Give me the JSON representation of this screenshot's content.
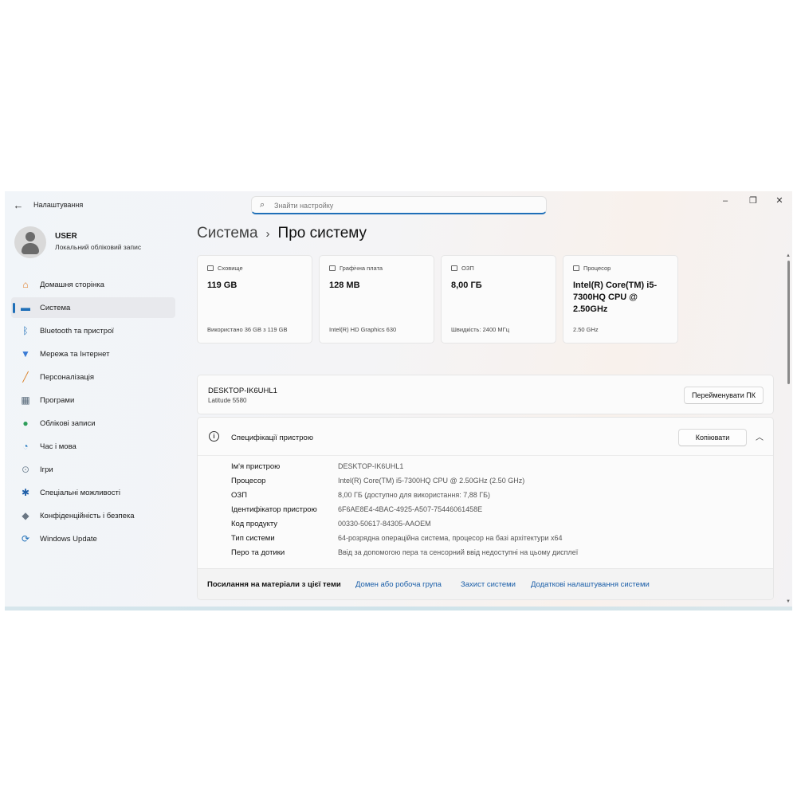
{
  "app": {
    "title": "Налаштування",
    "back_icon": "←",
    "window_controls": {
      "minimize": "–",
      "maximize": "❐",
      "close": "✕"
    }
  },
  "search": {
    "placeholder": "Знайти настройку"
  },
  "user": {
    "name": "USER",
    "subtitle": "Локальний обліковий запис"
  },
  "sidebar": {
    "items": [
      {
        "label": "Домашня сторінка",
        "icon": "home-icon",
        "glyph": "⌂",
        "color": "#e07b24",
        "active": false
      },
      {
        "label": "Система",
        "icon": "system-icon",
        "glyph": "▬",
        "color": "#1f6fb8",
        "active": true
      },
      {
        "label": "Bluetooth та пристрої",
        "icon": "bluetooth-icon",
        "glyph": "ᛒ",
        "color": "#1f6fb8",
        "active": false
      },
      {
        "label": "Мережа та Інтернет",
        "icon": "network-icon",
        "glyph": "▼",
        "color": "#3a7bd5",
        "active": false
      },
      {
        "label": "Персоналізація",
        "icon": "brush-icon",
        "glyph": "╱",
        "color": "#d9822b",
        "active": false
      },
      {
        "label": "Програми",
        "icon": "apps-icon",
        "glyph": "▦",
        "color": "#5a6b7b",
        "active": false
      },
      {
        "label": "Облікові записи",
        "icon": "accounts-icon",
        "glyph": "●",
        "color": "#2e9e5a",
        "active": false
      },
      {
        "label": "Час і мова",
        "icon": "time-language-icon",
        "glyph": "◔",
        "color": "#2f7fc1",
        "active": false
      },
      {
        "label": "Ігри",
        "icon": "gamepad-icon",
        "glyph": "⊙",
        "color": "#7a8a99",
        "active": false
      },
      {
        "label": "Спеціальні можливості",
        "icon": "accessibility-icon",
        "glyph": "✱",
        "color": "#1f5fa8",
        "active": false
      },
      {
        "label": "Конфіденційність і безпека",
        "icon": "shield-icon",
        "glyph": "◆",
        "color": "#6b7784",
        "active": false
      },
      {
        "label": "Windows Update",
        "icon": "windows-update-icon",
        "glyph": "⟳",
        "color": "#1f6fb8",
        "active": false
      }
    ]
  },
  "breadcrumb": {
    "parent": "Система",
    "separator": "›",
    "current": "Про систему"
  },
  "cards": [
    {
      "title": "Сховище",
      "icon": "storage-icon",
      "value": "119 GB",
      "footer": "Використано 36 GB з 119 GB"
    },
    {
      "title": "Графічна плата",
      "icon": "gpu-icon",
      "value": "128 MB",
      "footer": "Intel(R) HD Graphics 630"
    },
    {
      "title": "ОЗП",
      "icon": "ram-icon",
      "value": "8,00 ГБ",
      "footer": "Швидкість: 2400 МГц"
    },
    {
      "title": "Процесор",
      "icon": "cpu-icon",
      "value": "Intel(R) Core(TM) i5-7300HQ CPU @ 2.50GHz",
      "footer": "2.50 GHz"
    }
  ],
  "pc": {
    "name": "DESKTOP-IK6UHL1",
    "model": "Latitude 5580",
    "rename_label": "Перейменувати ПК"
  },
  "specs": {
    "title": "Специфікації пристрою",
    "copy_label": "Копіювати",
    "rows": [
      {
        "label": "Ім'я пристрою",
        "value": "DESKTOP-IK6UHL1"
      },
      {
        "label": "Процесор",
        "value": "Intel(R) Core(TM) i5-7300HQ CPU @ 2.50GHz (2.50 GHz)"
      },
      {
        "label": "ОЗП",
        "value": "8,00 ГБ (доступно для використання: 7,88 ГБ)"
      },
      {
        "label": "Ідентифікатор пристрою",
        "value": "6F6AE8E4-4BAC-4925-A507-75446061458E"
      },
      {
        "label": "Код продукту",
        "value": "00330-50617-84305-AAOEM"
      },
      {
        "label": "Тип системи",
        "value": "64-розрядна операційна система, процесор на базі архітектури x64"
      },
      {
        "label": "Перо та дотики",
        "value": "Ввід за допомогою пера та сенсорний ввід недоступні на цьому дисплеї"
      }
    ]
  },
  "related_links": {
    "title": "Посилання на матеріали з цієї теми",
    "links": [
      "Домен або робоча група",
      "Захист системи",
      "Додаткові налаштування системи"
    ]
  },
  "colors": {
    "accent": "#1f6fb8",
    "link": "#1a5ea8"
  }
}
